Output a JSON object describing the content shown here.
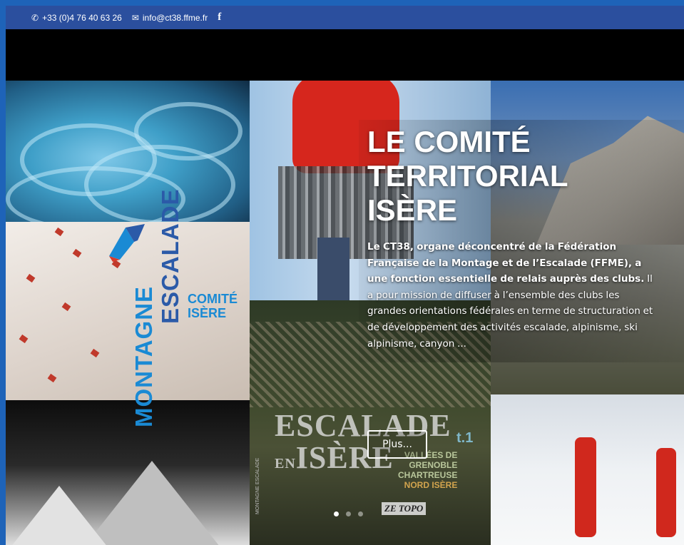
{
  "topbar": {
    "phone": "+33 (0)4 76 40 63 26",
    "email": "info@ct38.ffme.fr",
    "facebook": "f"
  },
  "hero": {
    "title_line1": "LE COMITÉ",
    "title_line2": "TERRITORIAL",
    "title_line3": "ISÈRE",
    "body_bold": "Le CT38, organe déconcentré de la Fédération Française de la Montage et de l’Escalade (FFME), a une fonction essentielle de relais auprès des clubs.",
    "body_rest": " Il a pour mission de diffuser à l’ensemble des clubs les grandes orientations fédérales en terme de structuration et de développement des activités escalade, alpinisme, ski alpinisme, canyon ...",
    "button_label": "Plus...",
    "slides_count": 3,
    "active_slide": 1
  },
  "brand": {
    "montagne": "MONTAGNE",
    "escalade": "ESCALADE",
    "comite": "COMITÉ",
    "isere": "ISÈRE"
  },
  "book": {
    "line1_big": "E",
    "line1_rest": "SCALADE",
    "line2_small": "EN",
    "line2_big": "I",
    "line2_rest": "SÈRE",
    "tome": "t.1",
    "valley1": "VALLÉES DE",
    "valley2": "GRENOBLE",
    "valley3": "CHARTREUSE",
    "valley4": "NORD ISÈRE",
    "zetopo": "ZE TOPO",
    "publisher": "MONTAGNE ESCALADE"
  },
  "colors": {
    "topbar_bg": "#2b4f9e",
    "brand_light_blue": "#1a8ad4",
    "brand_dark_blue": "#2b5aa8"
  },
  "icons": [
    "phone-icon",
    "envelope-icon",
    "facebook-icon"
  ]
}
